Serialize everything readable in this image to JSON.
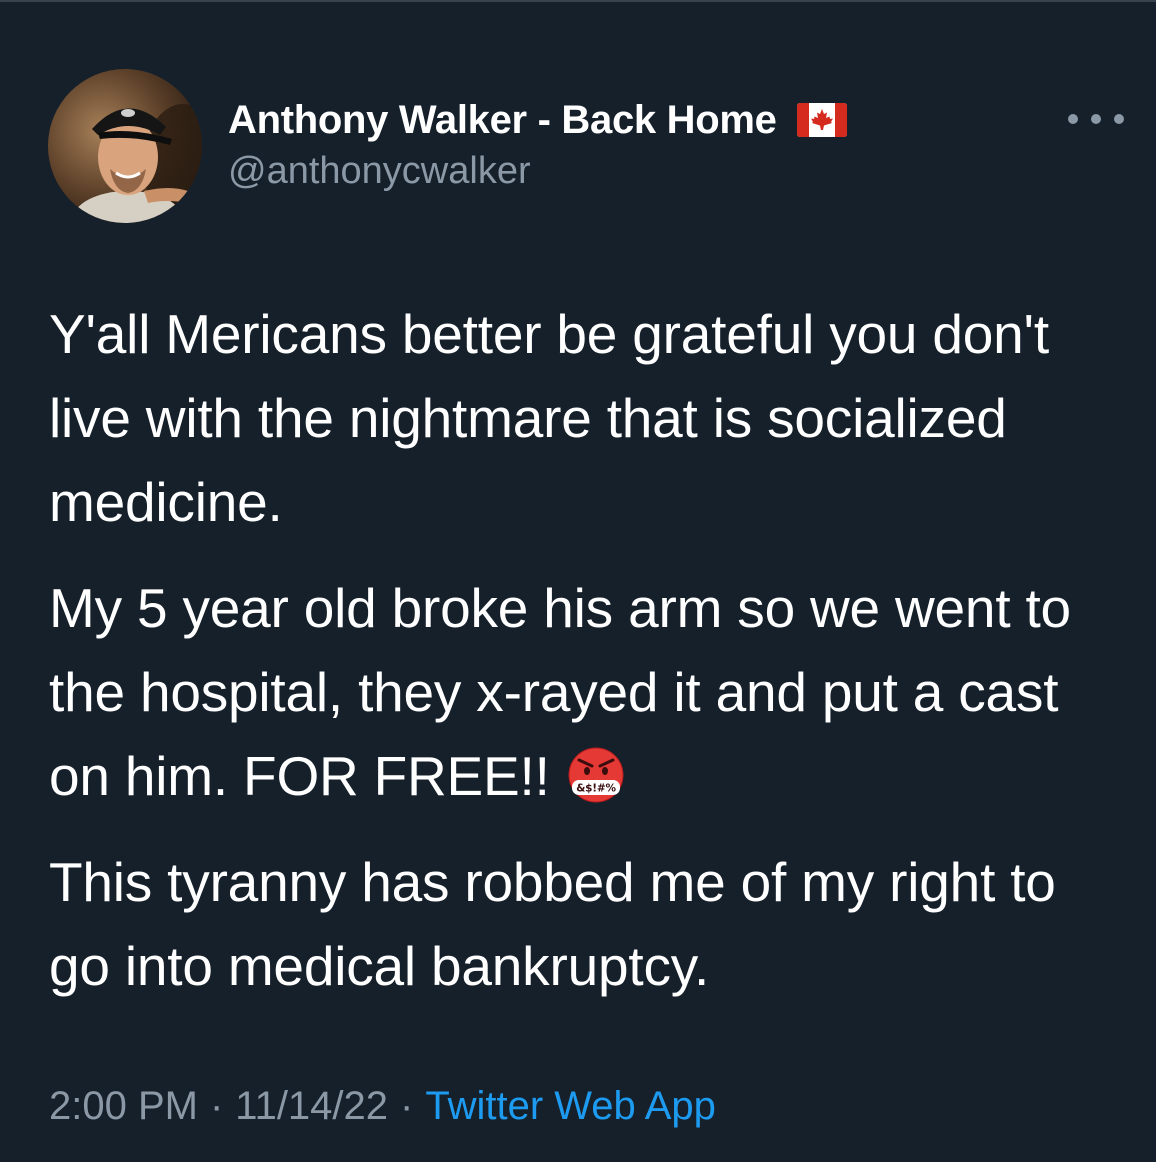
{
  "tweet": {
    "author": {
      "display_name": "Anthony Walker - Back Home",
      "handle": "@anthonycwalker",
      "flag_icon": "canada-flag-icon"
    },
    "more_icon": "more-options-icon",
    "paragraphs": [
      "Y'all Mericans better be grateful you don't live with the nightmare that is socialized medicine.",
      "My 5 year old broke his arm so we went to the hospital, they x-rayed it and put a cast on him. FOR FREE!!",
      "This tyranny has robbed me of my right to go into medical bankruptcy."
    ],
    "emoji": {
      "icon": "face-with-symbols-on-mouth-icon",
      "symbols": "&$!#%"
    },
    "time": "2:00 PM",
    "date": "11/14/22",
    "separator": "·",
    "source": "Twitter Web App"
  },
  "colors": {
    "background": "#15202b",
    "text": "#ffffff",
    "secondary_text": "#8b98a5",
    "link": "#1d9bf0",
    "divider": "#38444d"
  }
}
